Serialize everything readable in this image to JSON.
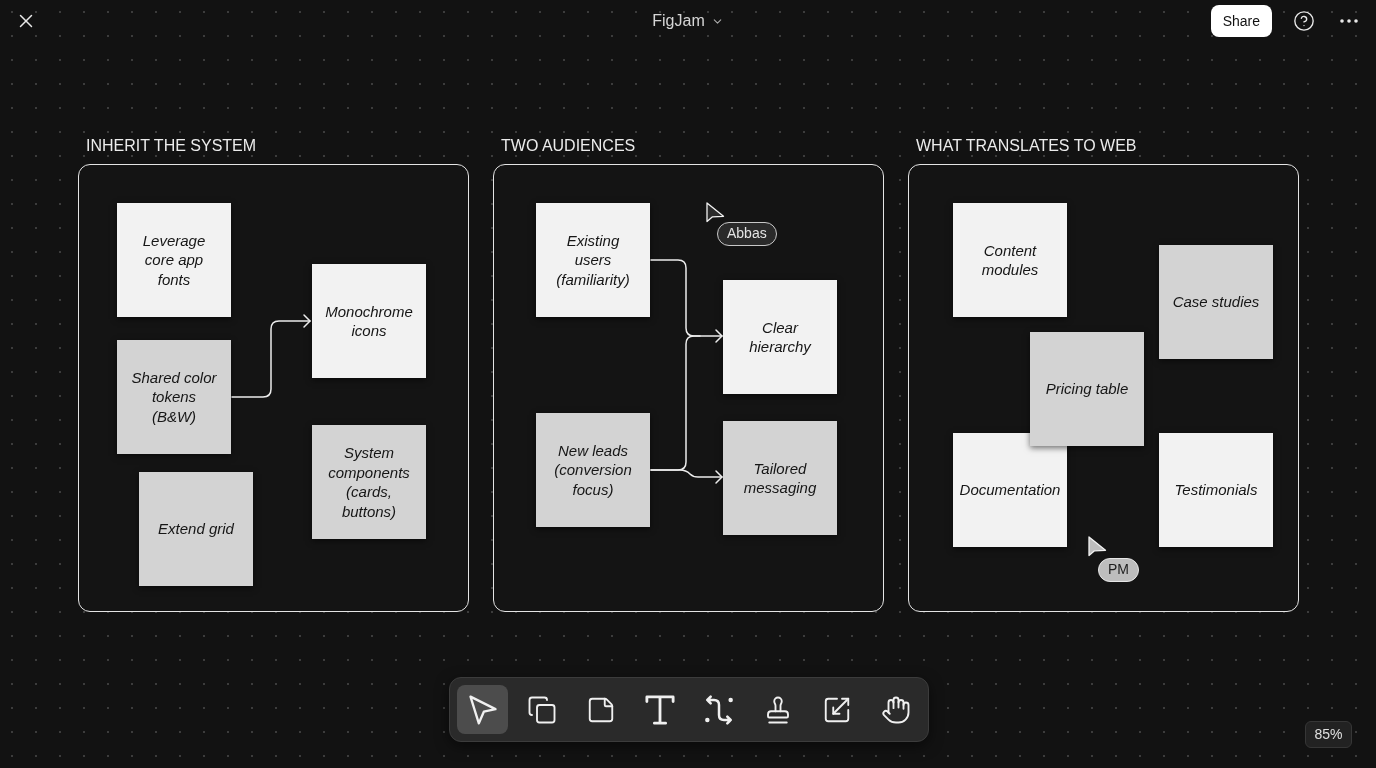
{
  "top_bar": {
    "title": "FigJam",
    "share_button": "Share"
  },
  "sections": [
    {
      "title": "INHERIT THE SYSTEM",
      "notes": [
        {
          "text": "Leverage core app fonts",
          "color": "#f2f2f2"
        },
        {
          "text": "Monochrome icons",
          "color": "#f2f2f2"
        },
        {
          "text": "Shared color tokens (B&W)",
          "color": "#d3d3d3"
        },
        {
          "text": "System components (cards, buttons)",
          "color": "#d3d3d3"
        },
        {
          "text": "Extend grid",
          "color": "#d3d3d3"
        }
      ]
    },
    {
      "title": "TWO AUDIENCES",
      "notes": [
        {
          "text": "Existing users (familiarity)",
          "color": "#f2f2f2"
        },
        {
          "text": "Clear hierarchy",
          "color": "#f2f2f2"
        },
        {
          "text": "New leads (conversion focus)",
          "color": "#d3d3d3"
        },
        {
          "text": "Tailored messaging",
          "color": "#d3d3d3"
        }
      ]
    },
    {
      "title": "WHAT TRANSLATES TO WEB",
      "notes": [
        {
          "text": "Content modules",
          "color": "#f2f2f2"
        },
        {
          "text": "Case studies",
          "color": "#d3d3d3"
        },
        {
          "text": "Pricing table",
          "color": "#d3d3d3"
        },
        {
          "text": "Documentation",
          "color": "#f2f2f2"
        },
        {
          "text": "Testimonials",
          "color": "#f2f2f2"
        }
      ]
    }
  ],
  "cursors": [
    {
      "name": "Abbas",
      "color": "#2a2a2a"
    },
    {
      "name": "PM",
      "color": "#bdbdbd"
    }
  ],
  "toolbar": [
    {
      "kind": "select",
      "selected": true
    },
    {
      "kind": "shapes",
      "selected": false
    },
    {
      "kind": "sticky",
      "selected": false
    },
    {
      "kind": "text",
      "selected": false
    },
    {
      "kind": "connector",
      "selected": false
    },
    {
      "kind": "stamp",
      "selected": false
    },
    {
      "kind": "section",
      "selected": false
    },
    {
      "kind": "hand",
      "selected": false
    }
  ],
  "zoom": "85%"
}
